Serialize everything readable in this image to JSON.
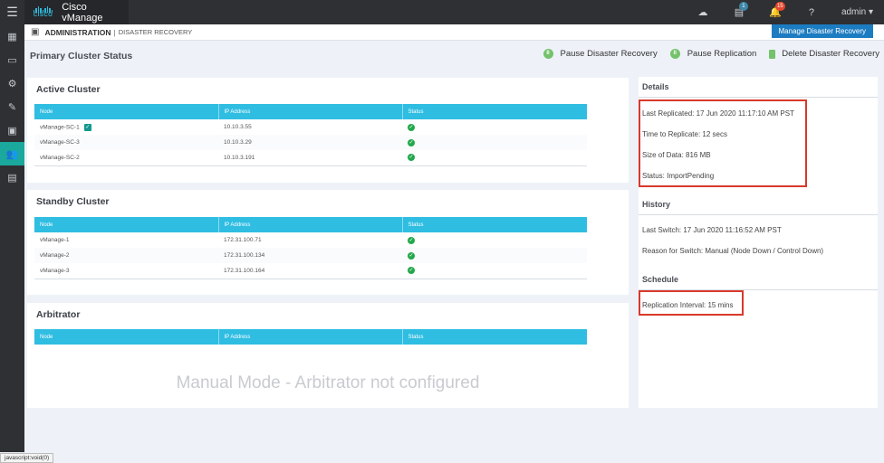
{
  "app": {
    "title": "Cisco vManage",
    "logo_text": "CISCO",
    "user": "admin",
    "notifications": {
      "tasks_count": "1",
      "alerts_count": "15"
    }
  },
  "topbar_icons": [
    "menu-icon",
    "cloud-icon",
    "tasks-icon",
    "bell-icon",
    "help-icon"
  ],
  "sidebar": {
    "items": [
      {
        "name": "dashboard",
        "icon": "dashboard-icon",
        "glyph": "▦",
        "active": false
      },
      {
        "name": "monitor",
        "icon": "monitor-icon",
        "glyph": "▭",
        "active": false
      },
      {
        "name": "configuration",
        "icon": "gear-icon",
        "glyph": "⚙",
        "active": false
      },
      {
        "name": "tools",
        "icon": "wrench-icon",
        "glyph": "🔧",
        "active": false
      },
      {
        "name": "maintenance",
        "icon": "briefcase-icon",
        "glyph": "💼",
        "active": false
      },
      {
        "name": "administration",
        "icon": "users-icon",
        "glyph": "👥",
        "active": true
      },
      {
        "name": "analytics",
        "icon": "analytics-icon",
        "glyph": "▤",
        "active": false
      }
    ]
  },
  "breadcrumb": {
    "main": "ADMINISTRATION",
    "separator": "|",
    "sub": "DISASTER RECOVERY"
  },
  "header": {
    "manage_button": "Manage Disaster Recovery",
    "page_title": "Primary Cluster Status"
  },
  "actions": {
    "pause_dr": "Pause Disaster Recovery",
    "pause_replication": "Pause Replication",
    "delete_dr": "Delete Disaster Recovery"
  },
  "table_columns": {
    "node": "Node",
    "ip": "IP Address",
    "status": "Status"
  },
  "active_cluster": {
    "title": "Active Cluster",
    "rows": [
      {
        "node": "vManage-SC-1",
        "ip": "10.10.3.55",
        "status": "ok",
        "primary": true
      },
      {
        "node": "vManage-SC-3",
        "ip": "10.10.3.29",
        "status": "ok",
        "primary": false
      },
      {
        "node": "vManage-SC-2",
        "ip": "10.10.3.191",
        "status": "ok",
        "primary": false
      }
    ]
  },
  "standby_cluster": {
    "title": "Standby Cluster",
    "rows": [
      {
        "node": "vManage-1",
        "ip": "172.31.100.71",
        "status": "ok"
      },
      {
        "node": "vManage-2",
        "ip": "172.31.100.134",
        "status": "ok"
      },
      {
        "node": "vManage-3",
        "ip": "172.31.100.164",
        "status": "ok"
      }
    ]
  },
  "arbitrator": {
    "title": "Arbitrator",
    "empty_message": "Manual Mode - Arbitrator not configured"
  },
  "details": {
    "title": "Details",
    "last_replicated": "Last Replicated: 17 Jun 2020 11:17:10 AM PST",
    "time_to_replicate": "Time to Replicate: 12 secs",
    "size_of_data": "Size of Data: 816 MB",
    "status": "Status: ImportPending"
  },
  "history": {
    "title": "History",
    "last_switch": "Last Switch: 17 Jun 2020 11:16:52 AM PST",
    "reason": "Reason for Switch: Manual (Node Down / Control Down)"
  },
  "schedule": {
    "title": "Schedule",
    "interval": "Replication Interval: 15 mins"
  },
  "status_bar": "javascript:void(0)",
  "colors": {
    "accent": "#2fbde2",
    "sidebar_active": "#1ba89d",
    "button_blue": "#1c7cc2",
    "status_ok": "#23a84b",
    "highlight_red": "#d8392b"
  }
}
